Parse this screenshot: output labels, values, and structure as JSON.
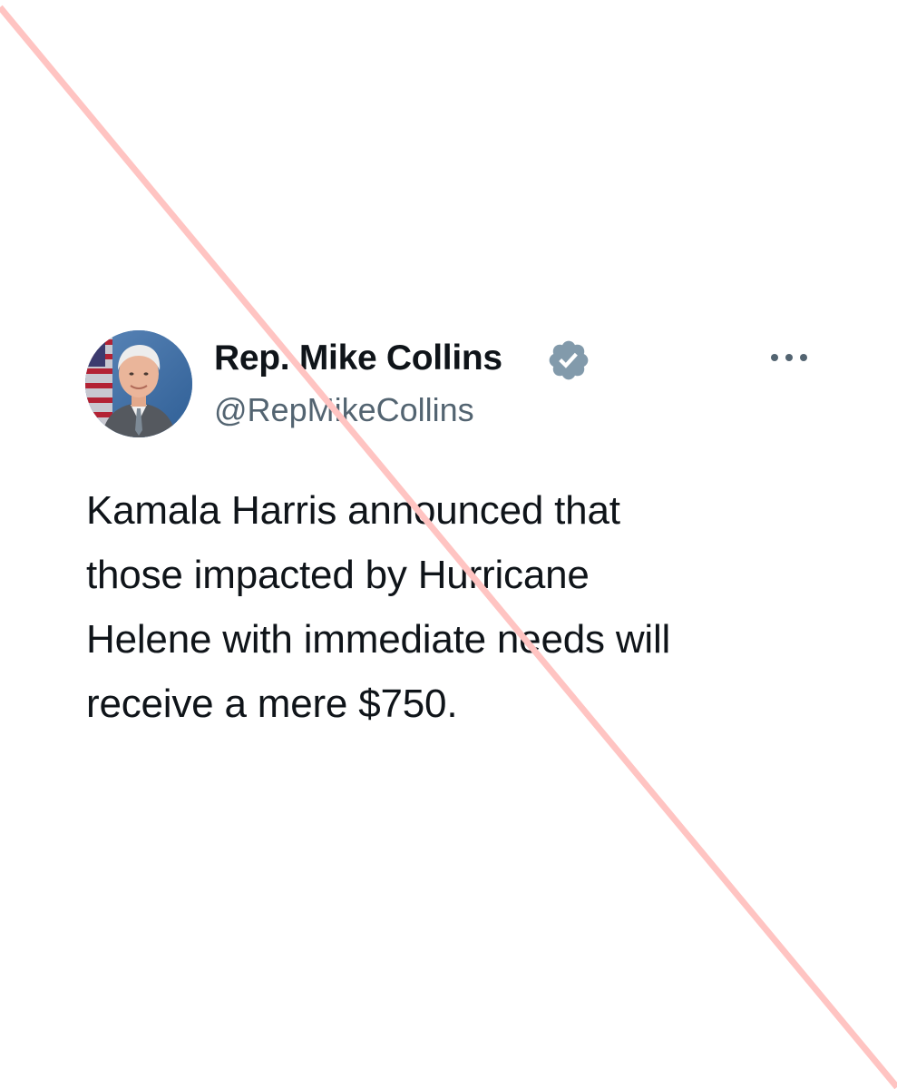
{
  "tweet": {
    "author": {
      "display_name": "Rep. Mike Collins",
      "handle": "@RepMikeCollins",
      "verified": true,
      "verified_badge_color": "#829aab"
    },
    "text": "Kamala Harris announced that\nthose impacted by Hurricane\nHelene with immediate needs will\nreceive a mere $750.",
    "more_icon": "ellipsis-icon"
  },
  "overlay": {
    "strike_color": "#ffc4c2"
  }
}
